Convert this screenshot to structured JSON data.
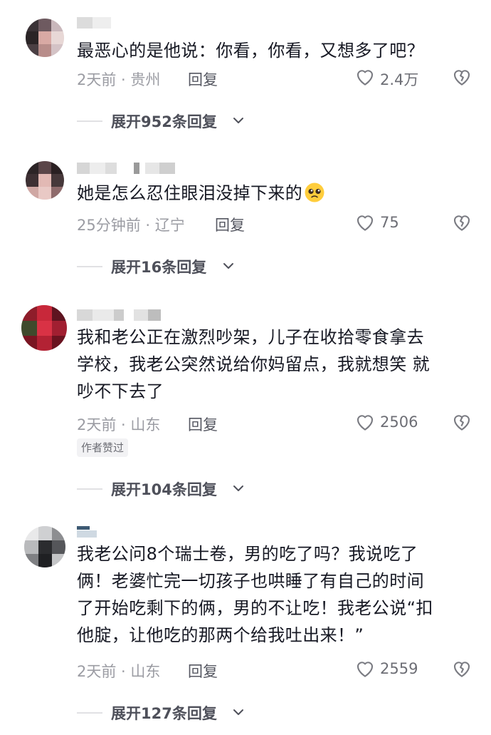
{
  "comments": [
    {
      "text": "最恶心的是他说：你看，你看，又想多了吧？",
      "time": "2天前 · 贵州",
      "reply": "回复",
      "likes": "2.4万",
      "expand": "展开952条回复"
    },
    {
      "text": "她是怎么忍住眼泪没掉下来的",
      "emoji": "pleading-face-emoji",
      "time": "25分钟前 · 辽宁",
      "reply": "回复",
      "likes": "75",
      "expand": "展开16条回复"
    },
    {
      "text_lines": [
        "我和老公正在激烈吵架，儿子在收拾零食拿去",
        "学校，我老公突然说给你妈留点，我就想笑 就",
        "吵不下去了"
      ],
      "time": "2天前 · 山东",
      "reply": "回复",
      "likes": "2506",
      "badge": "作者赞过",
      "expand": "展开104条回复"
    },
    {
      "text_lines": [
        "我老公问8个瑞士卷，男的吃了吗？我说吃了",
        "俩！老婆忙完一切孩子也哄睡了有自己的时间",
        "了开始吃剩下的俩，男的不让吃！我老公说“扣",
        "他腚，让他吃的那两个给我吐出来！”"
      ],
      "time": "2天前 · 山东",
      "reply": "回复",
      "likes": "2559",
      "expand": "展开127条回复"
    }
  ],
  "icons": {
    "like": "heart-outline-icon",
    "dislike": "broken-heart-icon",
    "expand": "chevron-down-icon"
  },
  "colors": {
    "text": "#161823",
    "meta": "#9b9ca3",
    "reply": "#555761",
    "expand": "#4e505a",
    "badge_bg": "#f2f2f4"
  }
}
